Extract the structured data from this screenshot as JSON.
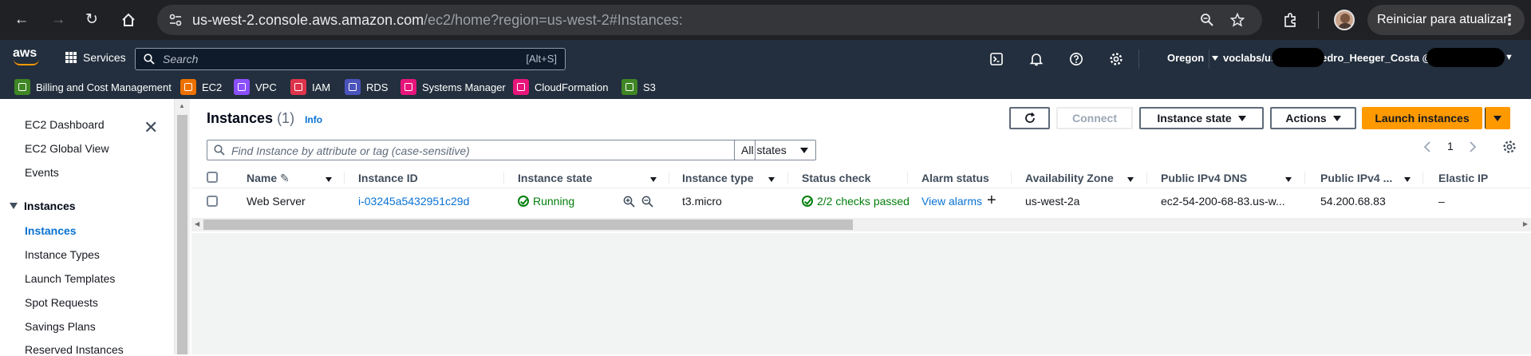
{
  "browser": {
    "url_main": "us-west-2.console.aws.amazon.com",
    "url_path": "/ec2/home?region=us-west-2#Instances:",
    "update_label": "Reiniciar para atualizar"
  },
  "aws_nav": {
    "logo": "aws",
    "services_label": "Services",
    "search_placeholder": "Search",
    "search_shortcut": "[Alt+S]",
    "region": "Oregon",
    "account_prefix": "voclabs/use",
    "account_name": "Pedro_Heeger_Costa @"
  },
  "favorites": [
    {
      "label": "Billing and Cost Management",
      "color": "#3f8624"
    },
    {
      "label": "EC2",
      "color": "#ed7100"
    },
    {
      "label": "VPC",
      "color": "#8c4fff"
    },
    {
      "label": "IAM",
      "color": "#dd344c"
    },
    {
      "label": "RDS",
      "color": "#4b53bc"
    },
    {
      "label": "Systems Manager",
      "color": "#e7157b"
    },
    {
      "label": "CloudFormation",
      "color": "#e7157b"
    },
    {
      "label": "S3",
      "color": "#3f8624"
    }
  ],
  "sidebar": {
    "items_top": [
      "EC2 Dashboard",
      "EC2 Global View",
      "Events"
    ],
    "section": "Instances",
    "items_section": [
      "Instances",
      "Instance Types",
      "Launch Templates",
      "Spot Requests",
      "Savings Plans",
      "Reserved Instances"
    ],
    "active": "Instances"
  },
  "page": {
    "title": "Instances",
    "count": "(1)",
    "info": "Info",
    "buttons": {
      "connect": "Connect",
      "instance_state": "Instance state",
      "actions": "Actions",
      "launch": "Launch instances"
    },
    "filter_placeholder": "Find Instance by attribute or tag (case-sensitive)",
    "state_filter": "All states",
    "page_number": "1"
  },
  "table": {
    "columns": [
      "Name",
      "Instance ID",
      "Instance state",
      "Instance type",
      "Status check",
      "Alarm status",
      "Availability Zone",
      "Public IPv4 DNS",
      "Public IPv4 ...",
      "Elastic IP"
    ],
    "row": {
      "name": "Web Server",
      "instance_id": "i-03245a5432951c29d",
      "state": "Running",
      "type": "t3.micro",
      "status_check": "2/2 checks passed",
      "alarm": "View alarms",
      "az": "us-west-2a",
      "dns": "ec2-54-200-68-83.us-w...",
      "ipv4": "54.200.68.83",
      "elastic_ip": "–"
    }
  },
  "colors": {
    "aws_nav": "#232f3e",
    "primary_button": "#ff9900",
    "link": "#0972d3",
    "success": "#037f0c"
  }
}
